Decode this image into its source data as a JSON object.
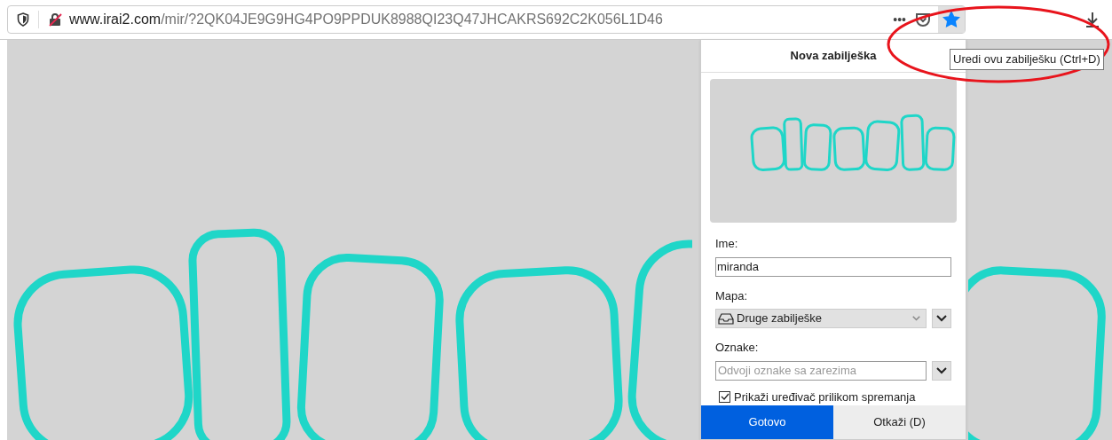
{
  "address_bar": {
    "domain": "www.irai2.com",
    "path": "/mir/?2QK04JE9G9HG4PO9PPDUK8988QI23Q47JHCAKRS692C2K056L1D46",
    "more": "•••",
    "bookmarked": true
  },
  "tooltip": "Uredi ovu zabilješku (Ctrl+D)",
  "bookmark_panel": {
    "title": "Nova zabilješka",
    "name_label": "Ime:",
    "name_value": "miranda",
    "folder_label": "Mapa:",
    "folder_value": "Druge zabilješke",
    "tags_label": "Oznake:",
    "tags_placeholder": "Odvoji oznake sa zarezima",
    "show_editor": {
      "label": "Prikaži uređivač prilikom spremanja",
      "checked": true
    },
    "buttons": [
      {
        "label": "Gotovo",
        "kind": "primary"
      },
      {
        "label": "Otkaži (D)",
        "kind": "secondary"
      }
    ]
  }
}
